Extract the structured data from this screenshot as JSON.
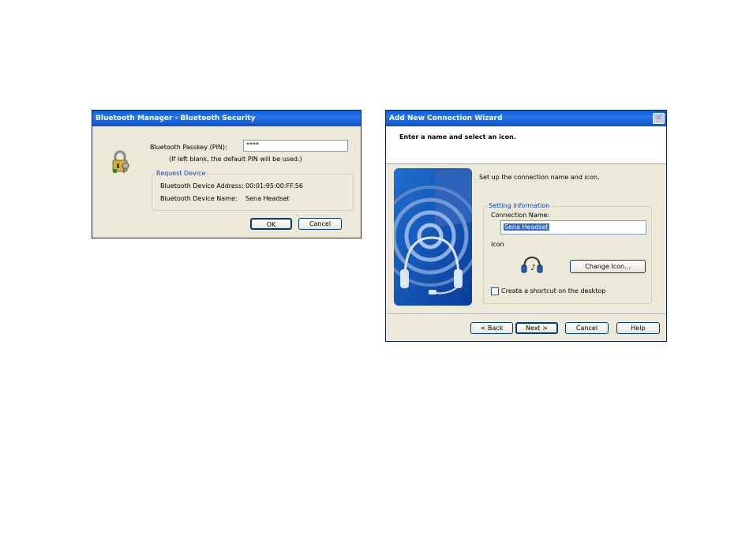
{
  "security_dialog": {
    "title": "Bluetooth Manager - Bluetooth Security",
    "passkey_label": "Bluetooth Passkey (PIN):",
    "passkey_value": "****",
    "hint": "(If left blank, the default PIN will be used.)",
    "group_title": "Request Device",
    "address_label": "Bluetooth Device Address:",
    "address_value": "00:01:95:00:FF:56",
    "name_label": "Bluetooth Device Name:",
    "name_value": "Sena Headset",
    "ok_label": "OK",
    "cancel_label": "Cancel",
    "icon": "lock-key-icon"
  },
  "wizard": {
    "title": "Add New Connection Wizard",
    "header": "Enter a name and select an icon.",
    "instruction": "Set up the connection name and icon.",
    "group_title": "Setting information",
    "connection_name_label": "Connection Name:",
    "connection_name_value": "Sena Headset",
    "icon_label": "Icon",
    "icon": "headset-icon",
    "change_icon_label": "Change Icon...",
    "shortcut_label": "Create a shortcut on the desktop",
    "shortcut_checked": false,
    "back_label": "< Back",
    "next_label": "Next >",
    "cancel_label": "Cancel",
    "help_label": "Help"
  },
  "colors": {
    "titlebar": "#0a5ed8",
    "dialog_bg": "#ece9d8",
    "group_title": "#0046d5",
    "selection": "#316ac5"
  }
}
